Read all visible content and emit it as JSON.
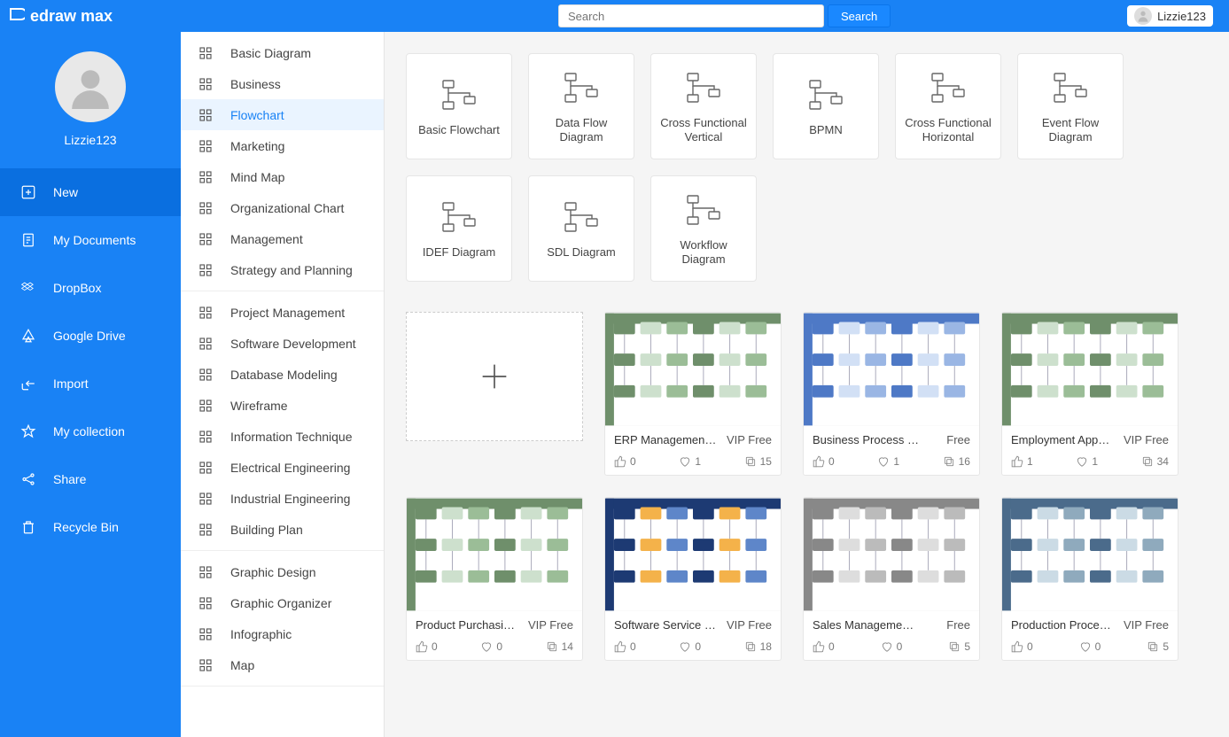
{
  "header": {
    "brand": "edraw max",
    "search_placeholder": "Search",
    "search_button": "Search",
    "username": "Lizzie123"
  },
  "sidebar": {
    "profile_name": "Lizzie123",
    "items": [
      {
        "label": "New",
        "icon": "plus-square-icon",
        "active": true
      },
      {
        "label": "My Documents",
        "icon": "document-icon"
      },
      {
        "label": "DropBox",
        "icon": "dropbox-icon"
      },
      {
        "label": "Google Drive",
        "icon": "gdrive-icon"
      },
      {
        "label": "Import",
        "icon": "import-icon"
      },
      {
        "label": "My collection",
        "icon": "star-icon"
      },
      {
        "label": "Share",
        "icon": "share-icon"
      },
      {
        "label": "Recycle Bin",
        "icon": "trash-icon"
      }
    ]
  },
  "categories": {
    "groups": [
      [
        {
          "label": "Basic Diagram"
        },
        {
          "label": "Business"
        },
        {
          "label": "Flowchart",
          "selected": true
        },
        {
          "label": "Marketing"
        },
        {
          "label": "Mind Map"
        },
        {
          "label": "Organizational Chart"
        },
        {
          "label": "Management"
        },
        {
          "label": "Strategy and Planning"
        }
      ],
      [
        {
          "label": "Project Management"
        },
        {
          "label": "Software Development"
        },
        {
          "label": "Database Modeling"
        },
        {
          "label": "Wireframe"
        },
        {
          "label": "Information Technique"
        },
        {
          "label": "Electrical Engineering"
        },
        {
          "label": "Industrial Engineering"
        },
        {
          "label": "Building Plan"
        }
      ],
      [
        {
          "label": "Graphic Design"
        },
        {
          "label": "Graphic Organizer"
        },
        {
          "label": "Infographic"
        },
        {
          "label": "Map"
        }
      ]
    ]
  },
  "types": [
    "Basic Flowchart",
    "Data Flow Diagram",
    "Cross Functional Vertical",
    "BPMN",
    "Cross Functional Horizontal",
    "Event Flow Diagram",
    "IDEF Diagram",
    "SDL Diagram",
    "Workflow Diagram"
  ],
  "templates": [
    {
      "title": "ERP Managemen…",
      "tag": "VIP Free",
      "likes": 0,
      "hearts": 1,
      "copies": 15,
      "palette": "green"
    },
    {
      "title": "Business Process Mo…",
      "tag": "Free",
      "likes": 0,
      "hearts": 1,
      "copies": 16,
      "palette": "blue"
    },
    {
      "title": "Employment App…",
      "tag": "VIP Free",
      "likes": 1,
      "hearts": 1,
      "copies": 34,
      "palette": "green"
    },
    {
      "title": "Product Purchasi…",
      "tag": "VIP Free",
      "likes": 0,
      "hearts": 0,
      "copies": 14,
      "palette": "green"
    },
    {
      "title": "Software Service …",
      "tag": "VIP Free",
      "likes": 0,
      "hearts": 0,
      "copies": 18,
      "palette": "navy"
    },
    {
      "title": "Sales Management C…",
      "tag": "Free",
      "likes": 0,
      "hearts": 0,
      "copies": 5,
      "palette": "grey"
    },
    {
      "title": "Production Proce…",
      "tag": "VIP Free",
      "likes": 0,
      "hearts": 0,
      "copies": 5,
      "palette": "slate"
    }
  ]
}
